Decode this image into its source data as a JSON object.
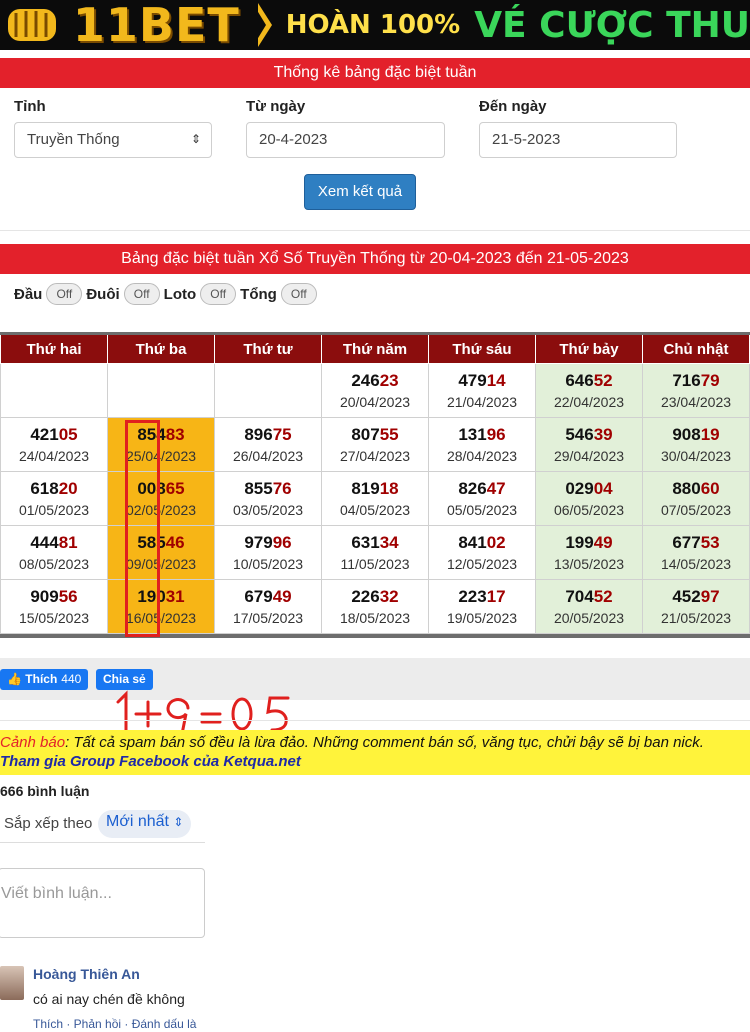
{
  "banner": {
    "logo": "11BET",
    "promo_left": "HOÀN 100%",
    "promo_right": "VÉ CƯỢC THU",
    "icon": "fist-icon"
  },
  "form": {
    "title": "Thống kê bảng đặc biệt tuần",
    "province_label": "Tỉnh",
    "province_value": "Truyền Thống",
    "from_label": "Từ ngày",
    "from_value": "20-4-2023",
    "to_label": "Đến ngày",
    "to_value": "21-5-2023",
    "submit_label": "Xem kết quả"
  },
  "result": {
    "title": "Bảng đặc biệt tuần Xổ Số Truyền Thống từ 20-04-2023 đến 21-05-2023",
    "toggles": [
      {
        "label": "Đầu",
        "state": "Off"
      },
      {
        "label": "Đuôi",
        "state": "Off"
      },
      {
        "label": "Loto",
        "state": "Off"
      },
      {
        "label": "Tổng",
        "state": "Off"
      }
    ],
    "headers": [
      "Thứ hai",
      "Thứ ba",
      "Thứ tư",
      "Thứ năm",
      "Thứ sáu",
      "Thứ bảy",
      "Chủ nhật"
    ],
    "rows": [
      [
        null,
        null,
        null,
        {
          "head": "246",
          "tail": "23",
          "date": "20/04/2023"
        },
        {
          "head": "479",
          "tail": "14",
          "date": "21/04/2023"
        },
        {
          "head": "646",
          "tail": "52",
          "date": "22/04/2023"
        },
        {
          "head": "716",
          "tail": "79",
          "date": "23/04/2023"
        }
      ],
      [
        {
          "head": "421",
          "tail": "05",
          "date": "24/04/2023"
        },
        {
          "head": "854",
          "tail": "83",
          "date": "25/04/2023"
        },
        {
          "head": "896",
          "tail": "75",
          "date": "26/04/2023"
        },
        {
          "head": "807",
          "tail": "55",
          "date": "27/04/2023"
        },
        {
          "head": "131",
          "tail": "96",
          "date": "28/04/2023"
        },
        {
          "head": "546",
          "tail": "39",
          "date": "29/04/2023"
        },
        {
          "head": "908",
          "tail": "19",
          "date": "30/04/2023"
        }
      ],
      [
        {
          "head": "618",
          "tail": "20",
          "date": "01/05/2023"
        },
        {
          "head": "008",
          "tail": "65",
          "date": "02/05/2023"
        },
        {
          "head": "855",
          "tail": "76",
          "date": "03/05/2023"
        },
        {
          "head": "819",
          "tail": "18",
          "date": "04/05/2023"
        },
        {
          "head": "826",
          "tail": "47",
          "date": "05/05/2023"
        },
        {
          "head": "029",
          "tail": "04",
          "date": "06/05/2023"
        },
        {
          "head": "880",
          "tail": "60",
          "date": "07/05/2023"
        }
      ],
      [
        {
          "head": "444",
          "tail": "81",
          "date": "08/05/2023"
        },
        {
          "head": "585",
          "tail": "46",
          "date": "09/05/2023"
        },
        {
          "head": "979",
          "tail": "96",
          "date": "10/05/2023"
        },
        {
          "head": "631",
          "tail": "34",
          "date": "11/05/2023"
        },
        {
          "head": "841",
          "tail": "02",
          "date": "12/05/2023"
        },
        {
          "head": "199",
          "tail": "49",
          "date": "13/05/2023"
        },
        {
          "head": "677",
          "tail": "53",
          "date": "14/05/2023"
        }
      ],
      [
        {
          "head": "909",
          "tail": "56",
          "date": "15/05/2023"
        },
        {
          "head": "190",
          "tail": "31",
          "date": "16/05/2023"
        },
        {
          "head": "679",
          "tail": "49",
          "date": "17/05/2023"
        },
        {
          "head": "226",
          "tail": "32",
          "date": "18/05/2023"
        },
        {
          "head": "223",
          "tail": "17",
          "date": "19/05/2023"
        },
        {
          "head": "704",
          "tail": "52",
          "date": "20/05/2023"
        },
        {
          "head": "452",
          "tail": "97",
          "date": "21/05/2023"
        }
      ]
    ]
  },
  "social": {
    "like_label": "Thích",
    "like_count": "440",
    "share_label": "Chia sẻ"
  },
  "handwriting": "1+9=05",
  "warning": {
    "prefix": "Cảnh báo",
    "text": ": Tất cả spam bán số đều là lừa đảo. Những comment bán số, văng tục, chửi bậy sẽ bị ban nick.",
    "group_link": "Tham gia Group Facebook của Ketqua.net"
  },
  "comments": {
    "count_label": "666 bình luận",
    "sort_label": "Sắp xếp theo",
    "sort_value": "Mới nhất",
    "placeholder": "Viết bình luận...",
    "items": [
      {
        "author": "Hoàng Thiên An",
        "text": "có ai nay chén đề không",
        "actions": "Thích · Phản hồi · Đánh dấu là"
      }
    ]
  },
  "colors": {
    "accent_red": "#e3212b",
    "header_dark_red": "#8b0d0d",
    "highlight": "#f7b516",
    "weekend": "#e2f0d9",
    "button_blue": "#2f7fc2"
  }
}
